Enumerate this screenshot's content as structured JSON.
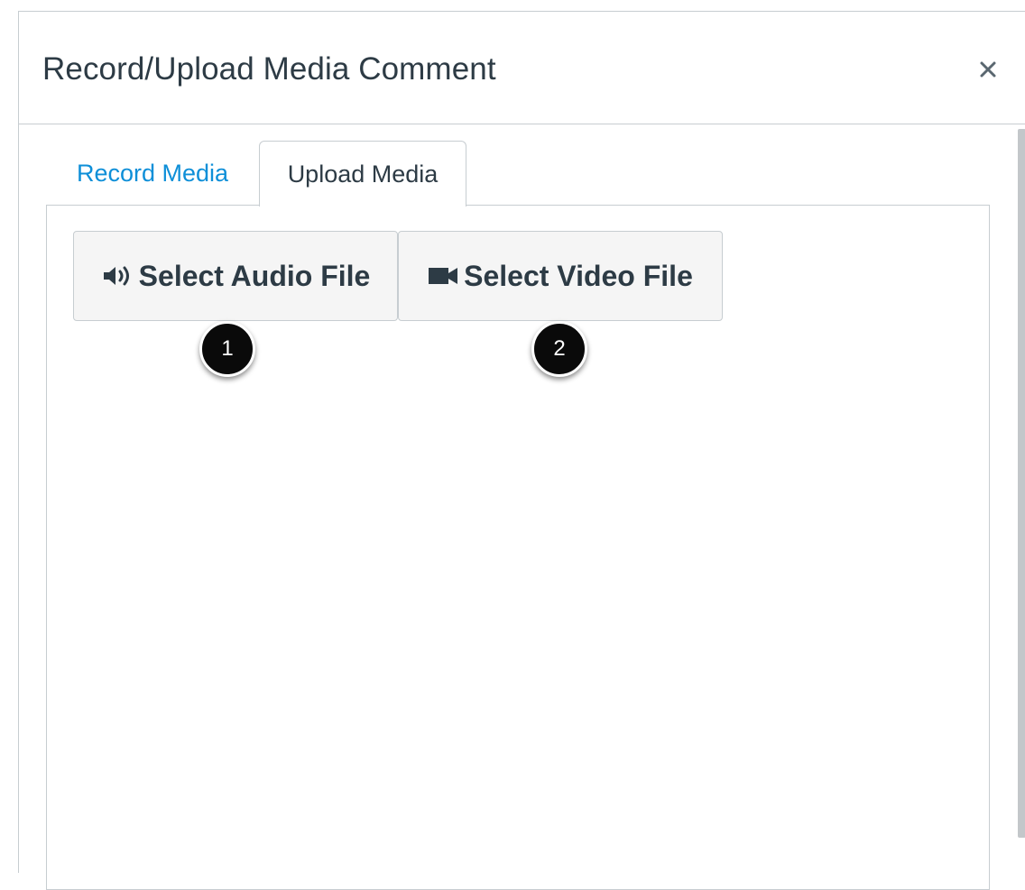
{
  "dialog": {
    "title": "Record/Upload Media Comment",
    "close_icon": "close-icon"
  },
  "tabs": [
    {
      "label": "Record Media",
      "active": false
    },
    {
      "label": "Upload Media",
      "active": true
    }
  ],
  "upload_panel": {
    "audio_button": {
      "label": "Select Audio File",
      "icon": "speaker-icon"
    },
    "video_button": {
      "label": "Select Video File",
      "icon": "video-camera-icon"
    }
  },
  "callouts": [
    {
      "number": "1"
    },
    {
      "number": "2"
    }
  ],
  "colors": {
    "link_blue": "#0e8fd8",
    "text_dark": "#2d3b45",
    "border": "#c7cdd1",
    "button_bg": "#f5f5f5",
    "badge_bg": "#0a0a0a"
  }
}
